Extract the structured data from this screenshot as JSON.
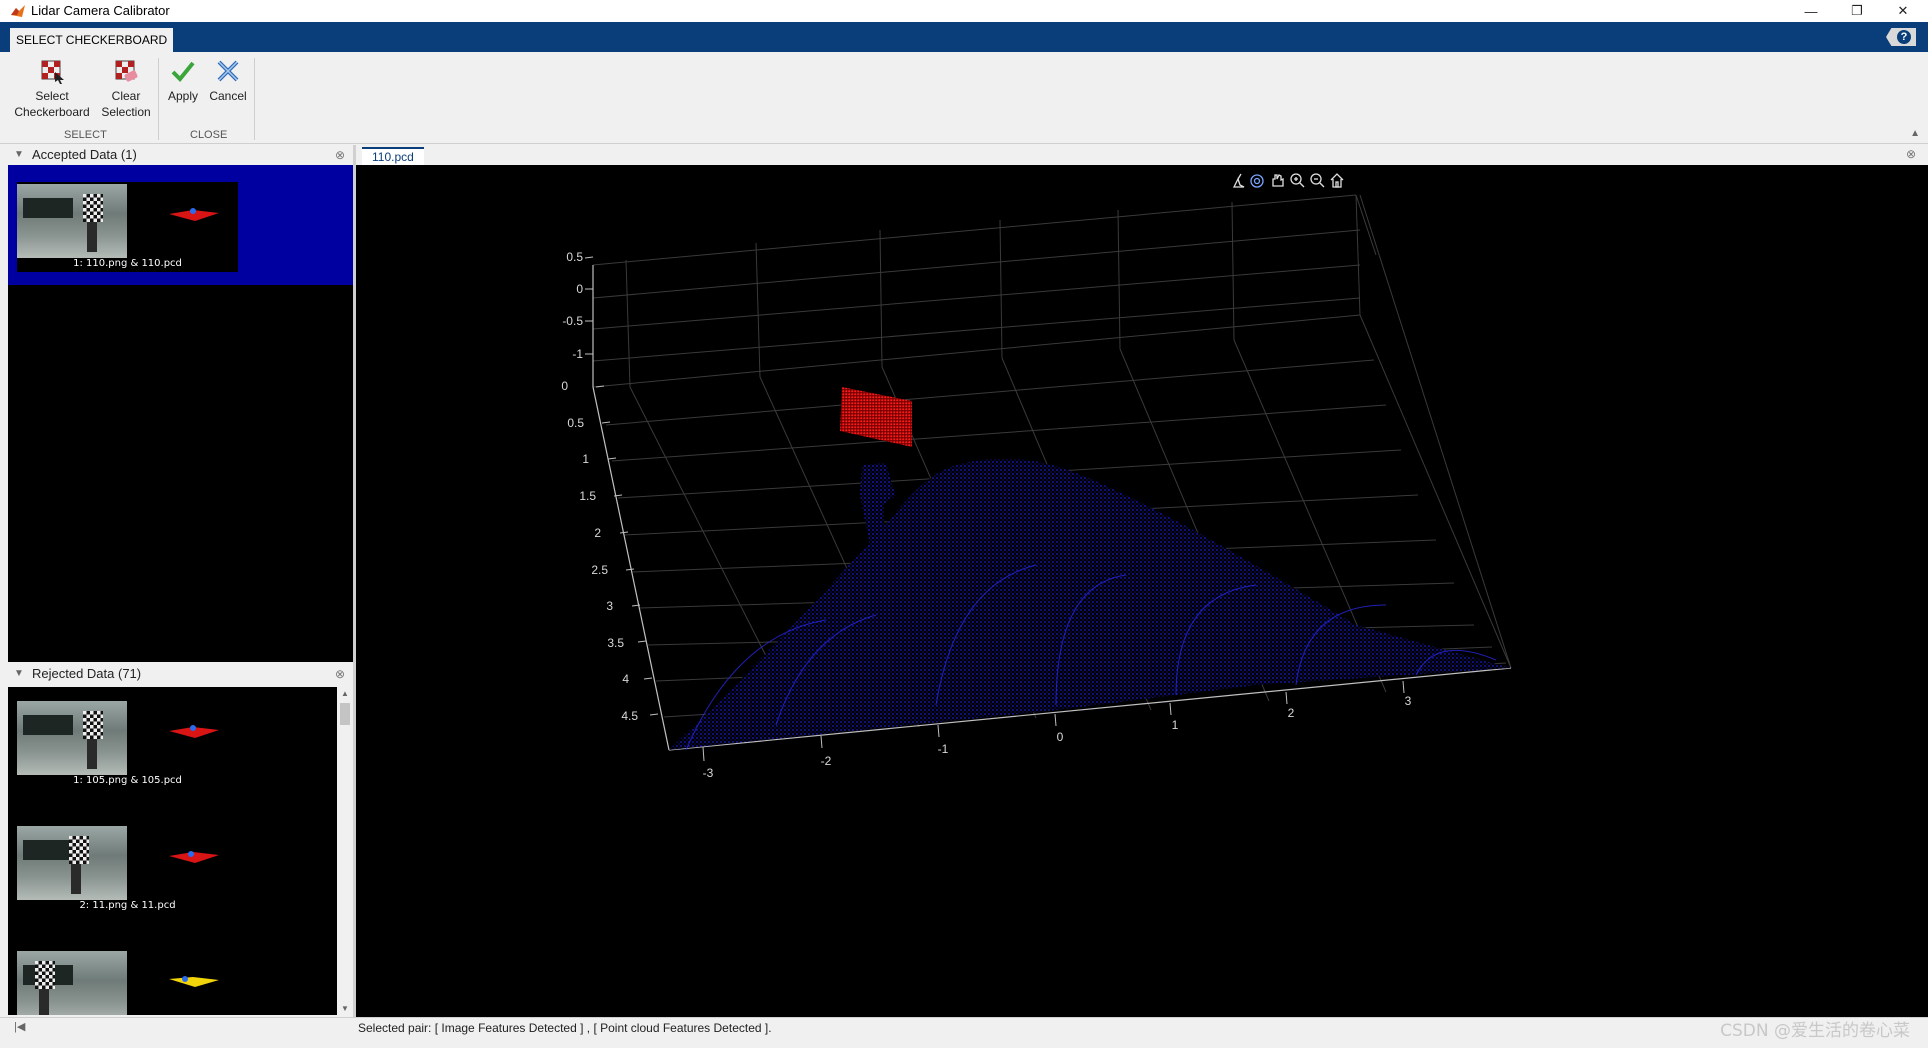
{
  "window": {
    "title": "Lidar Camera Calibrator"
  },
  "tabs": {
    "active": "SELECT CHECKERBOARD"
  },
  "toolstrip": {
    "select_checkerboard": "Select Checkerboard",
    "clear_selection": "Clear Selection",
    "apply": "Apply",
    "cancel": "Cancel",
    "group_select": "SELECT",
    "group_close": "CLOSE"
  },
  "accepted": {
    "header": "Accepted Data (1)",
    "items": [
      {
        "label": "1: 110.png & 110.pcd"
      }
    ]
  },
  "rejected": {
    "header": "Rejected Data (71)",
    "items": [
      {
        "label": "1: 105.png & 105.pcd"
      },
      {
        "label": "2: 11.png & 11.pcd"
      }
    ]
  },
  "figure": {
    "tab": "110.pcd",
    "axes": {
      "z_ticks": [
        "0.5",
        "0",
        "-0.5",
        "-1"
      ],
      "y_ticks": [
        "0",
        "0.5",
        "1",
        "1.5",
        "2",
        "2.5",
        "3",
        "3.5",
        "4",
        "4.5"
      ],
      "x_ticks": [
        "-3",
        "-2",
        "-1",
        "0",
        "1",
        "2",
        "3"
      ]
    }
  },
  "status": {
    "text": "Selected pair: [ Image Features Detected ] , [ Point cloud Features Detected ]."
  },
  "watermark": "CSDN @爱生活的卷心菜",
  "colors": {
    "accent": "#0a3e7a",
    "selection": "#0000a0",
    "pointcloud": "#1a1adc",
    "checkerboard_points": "#ff1a1a"
  }
}
